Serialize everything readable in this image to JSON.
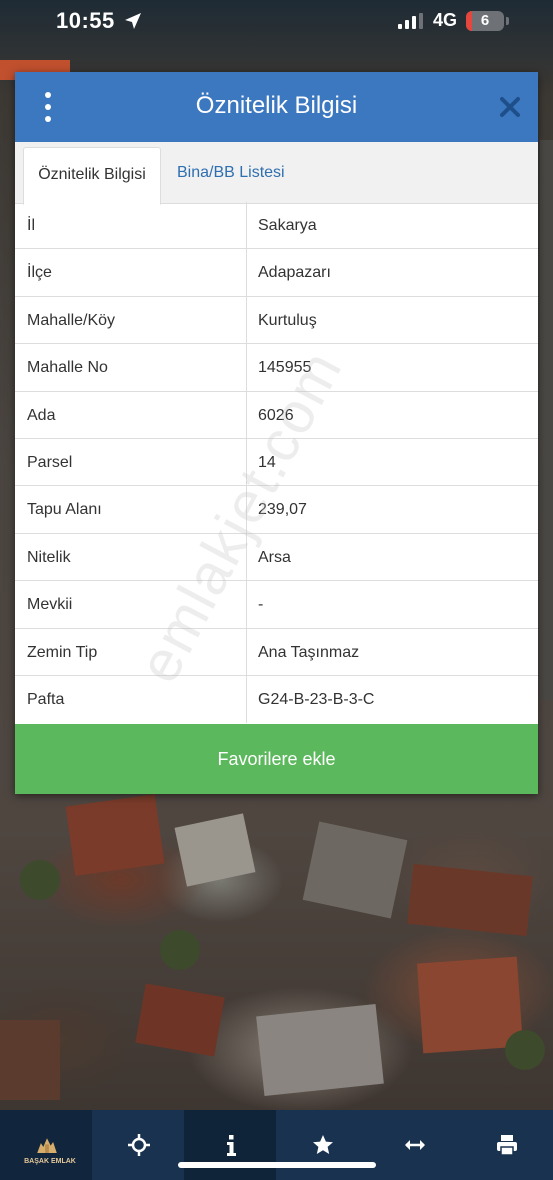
{
  "status_bar": {
    "time": "10:55",
    "network": "4G",
    "battery_level": "6",
    "battery_fraction": 0.06
  },
  "dialog": {
    "title": "Öznitelik Bilgisi",
    "menu_icon": "more-vertical-icon",
    "close_icon": "close-icon",
    "tabs": [
      {
        "label": "Öznitelik Bilgisi",
        "active": true
      },
      {
        "label": "Bina/BB Listesi",
        "active": false
      }
    ],
    "rows": [
      {
        "key": "İl",
        "value": "Sakarya"
      },
      {
        "key": "İlçe",
        "value": "Adapazarı"
      },
      {
        "key": "Mahalle/Köy",
        "value": "Kurtuluş"
      },
      {
        "key": "Mahalle No",
        "value": "145955"
      },
      {
        "key": "Ada",
        "value": "6026"
      },
      {
        "key": "Parsel",
        "value": "14"
      },
      {
        "key": "Tapu Alanı",
        "value": "239,07"
      },
      {
        "key": "Nitelik",
        "value": "Arsa"
      },
      {
        "key": "Mevkii",
        "value": "-"
      },
      {
        "key": "Zemin Tip",
        "value": "Ana Taşınmaz"
      },
      {
        "key": "Pafta",
        "value": "G24-B-23-B-3-C"
      }
    ],
    "favorite_button": "Favorilere ekle",
    "watermark": "emlakjet.com"
  },
  "toolbar": {
    "logo_text": "BAŞAK EMLAK",
    "items": [
      {
        "icon": "crosshair-icon"
      },
      {
        "icon": "info-icon",
        "active": true
      },
      {
        "icon": "star-icon"
      },
      {
        "icon": "measure-arrows-icon"
      },
      {
        "icon": "printer-icon"
      }
    ]
  },
  "colors": {
    "header": "#3c78c0",
    "tab_link": "#2f6fb0",
    "button": "#5cb85c",
    "toolbar": "#18324f"
  }
}
